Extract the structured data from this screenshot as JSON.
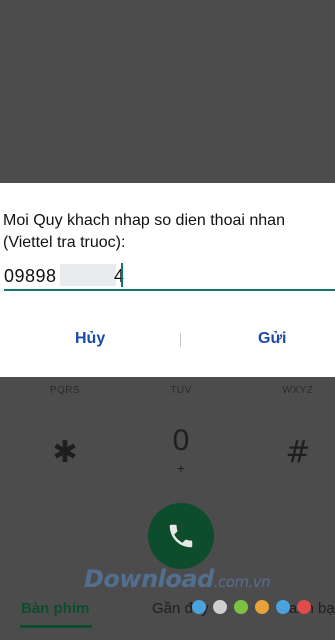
{
  "dialog": {
    "message": "Moi Quy khach nhap so dien thoai nhan (Viettel tra truoc):",
    "input_prefix": "09898",
    "input_suffix": "4",
    "cancel_label": "Hủy",
    "send_label": "Gửi"
  },
  "keypad": {
    "row3_letters": [
      "PQRS",
      "TUV",
      "WXYZ"
    ],
    "star": "✱",
    "zero": "0",
    "plus": "+",
    "hash": "#"
  },
  "tabs": {
    "keypad": "Bàn phím",
    "recent": "Gần đây",
    "contacts": "Danh bạ"
  },
  "watermark": {
    "brand": "Download",
    "domain": ".com.vn"
  },
  "colors": {
    "accent": "#107870",
    "call": "#0d4d2c",
    "dialog_buttons": "#1b4aa6"
  }
}
